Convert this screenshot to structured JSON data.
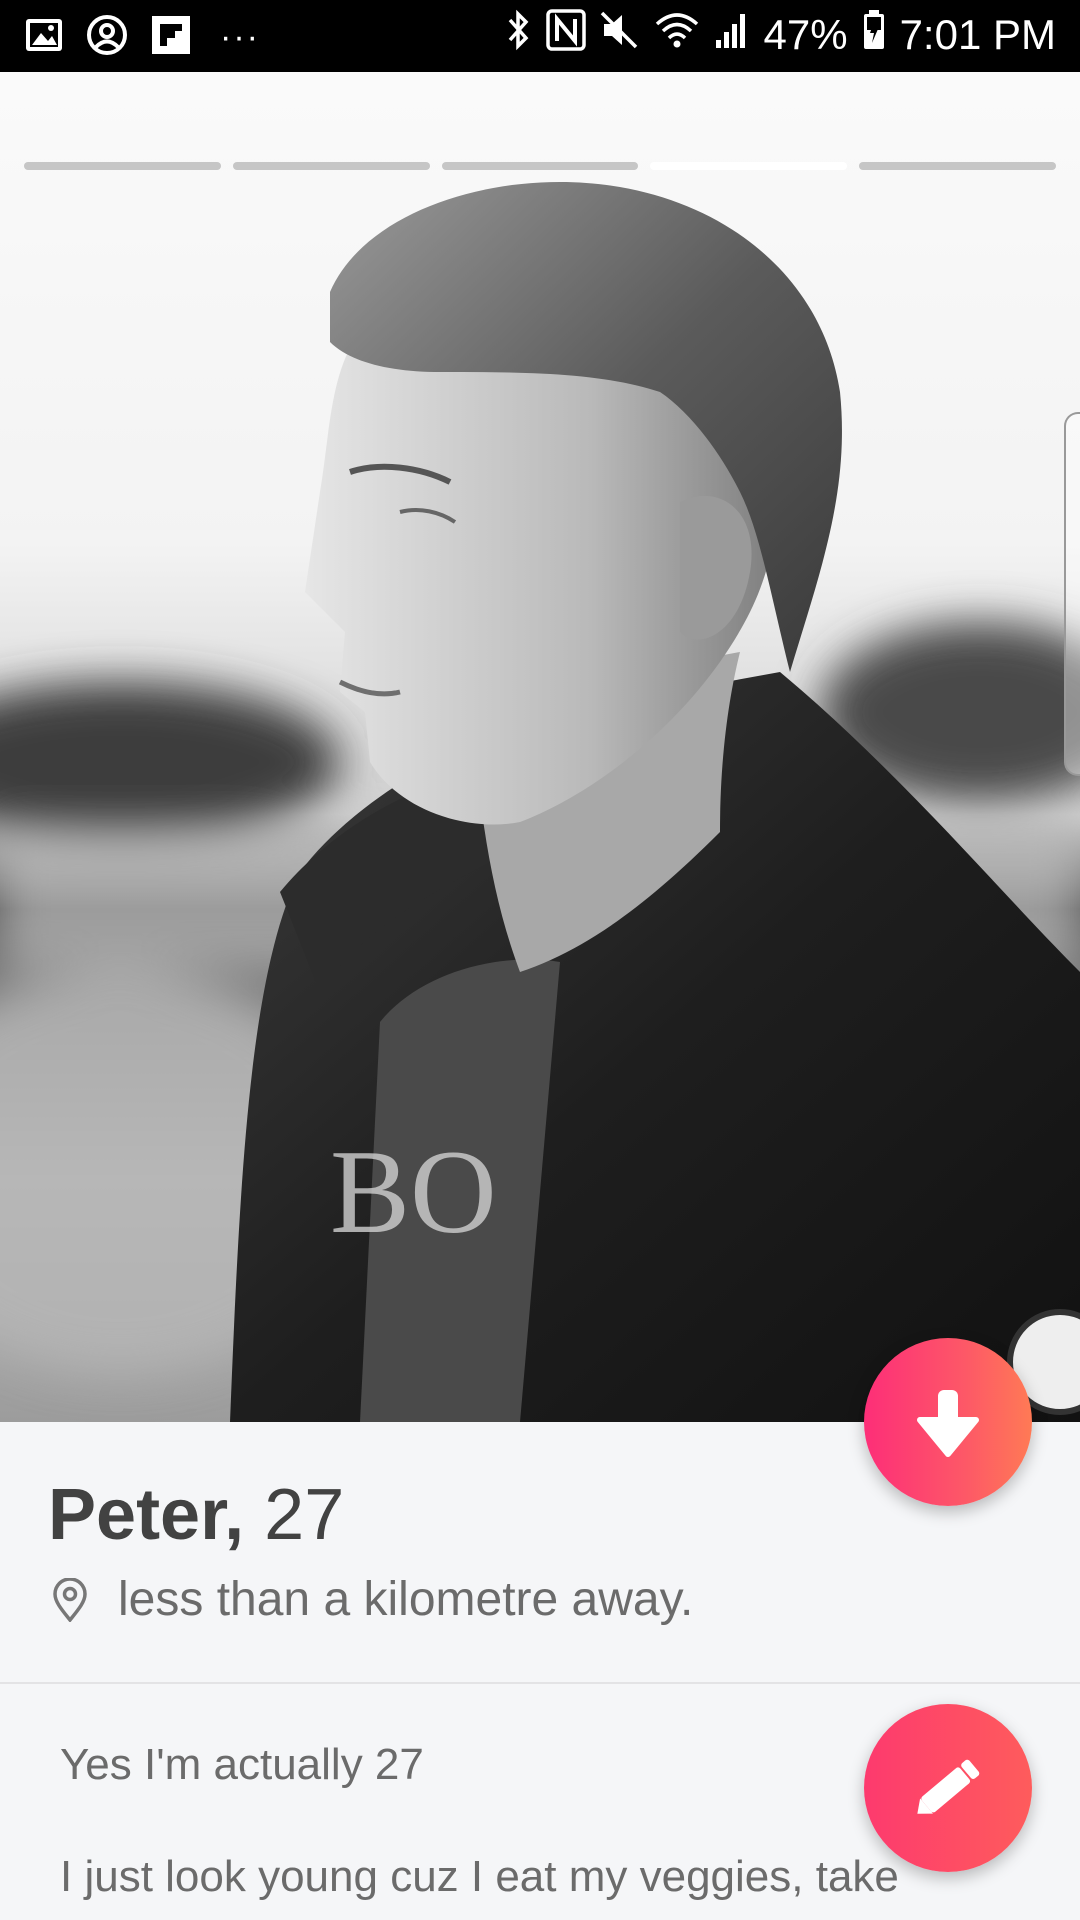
{
  "status_bar": {
    "battery_percent": "47%",
    "time": "7:01 PM",
    "overflow": "···",
    "left_icons": [
      "gallery-icon",
      "account-circle-icon",
      "flipboard-icon"
    ],
    "right_icons": [
      "bluetooth-icon",
      "nfc-icon",
      "mute-icon",
      "wifi-icon",
      "signal-icon",
      "battery-icon"
    ]
  },
  "photo_progress": {
    "total": 5,
    "active_index": 3
  },
  "profile": {
    "name": "Peter,",
    "age": "27",
    "distance": "less than a kilometre away.",
    "bio_line1": "Yes I'm actually 27",
    "bio_line2": "I just look young cuz I eat my veggies, take"
  },
  "colors": {
    "accent_start": "#fd2e78",
    "accent_end": "#ff7a55",
    "text_dark": "#424242",
    "text_muted": "#6b6b6b"
  }
}
